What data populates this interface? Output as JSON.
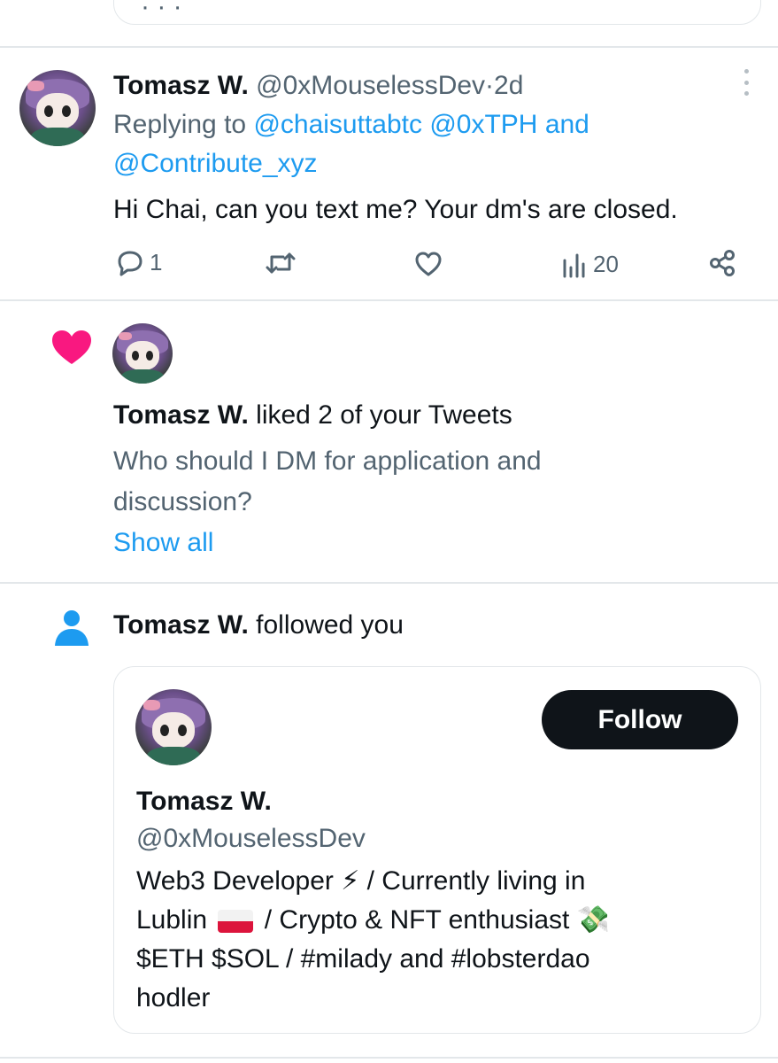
{
  "top_card": {
    "fragment": "·  ·  ·"
  },
  "reply_tweet": {
    "name": "Tomasz W.",
    "handle": "@0xMouselessDev",
    "separator": "·",
    "time": "2d",
    "replying_prefix": "Replying to",
    "reply_to_1": "@chaisuttabtc",
    "reply_to_2": "@0xTPH",
    "reply_and": "and",
    "reply_to_3": "@Contribute_xyz",
    "text": "Hi Chai, can you text me? Your dm's are closed.",
    "actions": {
      "reply_count": "1",
      "retweet_count": "",
      "like_count": "",
      "views_count": "20"
    }
  },
  "like_notification": {
    "name": "Tomasz W.",
    "action_text": "liked 2 of your Tweets",
    "preview_line_1": "Who should I DM for application and",
    "preview_line_2": "discussion?",
    "show_all": "Show all"
  },
  "follow_notification": {
    "name": "Tomasz W.",
    "action_text": "followed you",
    "card": {
      "follow_label": "Follow",
      "name": "Tomasz W.",
      "handle": "@0xMouselessDev",
      "bio_line_1": "Web3 Developer ⚡ / Currently living in",
      "bio_line_2_a": "Lublin",
      "bio_line_2_b": "/ Crypto & NFT enthusiast 💸",
      "bio_line_3": "$ETH $SOL / #milady and #lobsterdao",
      "bio_line_4": "hodler"
    }
  },
  "colors": {
    "link": "#1d9bf0",
    "like_heart": "#f91880",
    "follow_person": "#1d9bf0",
    "follow_button_bg": "#0f1419",
    "secondary_text": "#536471"
  },
  "icons": [
    "reply-icon",
    "retweet-icon",
    "like-icon",
    "views-icon",
    "share-icon",
    "heart-icon",
    "person-icon",
    "more-icon",
    "poland-flag-icon"
  ]
}
